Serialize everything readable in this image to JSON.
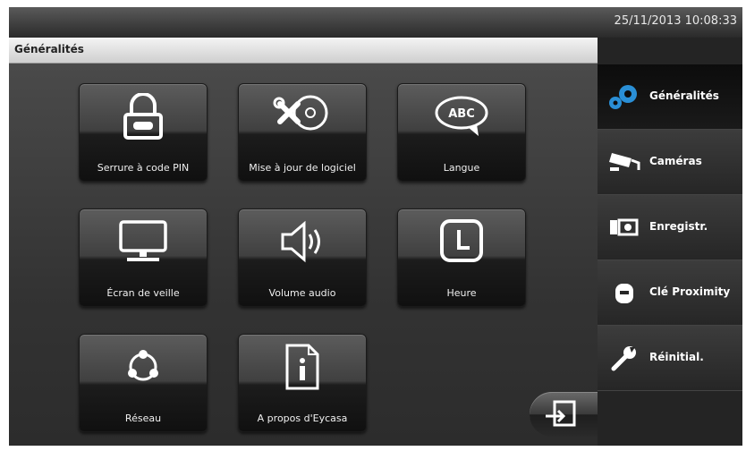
{
  "status": {
    "datetime": "25/11/2013 10:08:33"
  },
  "page": {
    "title": "Généralités"
  },
  "tiles": [
    {
      "label": "Serrure à code PIN",
      "icon": "padlock-icon"
    },
    {
      "label": "Mise à jour de logiciel",
      "icon": "software-update-icon"
    },
    {
      "label": "Langue",
      "icon": "language-bubble-icon"
    },
    {
      "label": "Écran de veille",
      "icon": "monitor-icon"
    },
    {
      "label": "Volume audio",
      "icon": "speaker-icon"
    },
    {
      "label": "Heure",
      "icon": "clock-icon"
    },
    {
      "label": "Réseau",
      "icon": "network-icon"
    },
    {
      "label": "A propos d'Eycasa",
      "icon": "info-document-icon"
    }
  ],
  "language_icon_text": "ABC",
  "sidebar": {
    "items": [
      {
        "label": "Généralités",
        "icon": "gears-icon",
        "active": true
      },
      {
        "label": "Caméras",
        "icon": "camera-icon",
        "active": false
      },
      {
        "label": "Enregistr.",
        "icon": "recording-icon",
        "active": false
      },
      {
        "label": "Clé Proximity",
        "icon": "proximity-key-icon",
        "active": false
      },
      {
        "label": "Réinitial.",
        "icon": "wrench-icon",
        "active": false
      }
    ]
  },
  "colors": {
    "accent": "#2a8fd6",
    "tile_text": "#f0f0f0"
  }
}
